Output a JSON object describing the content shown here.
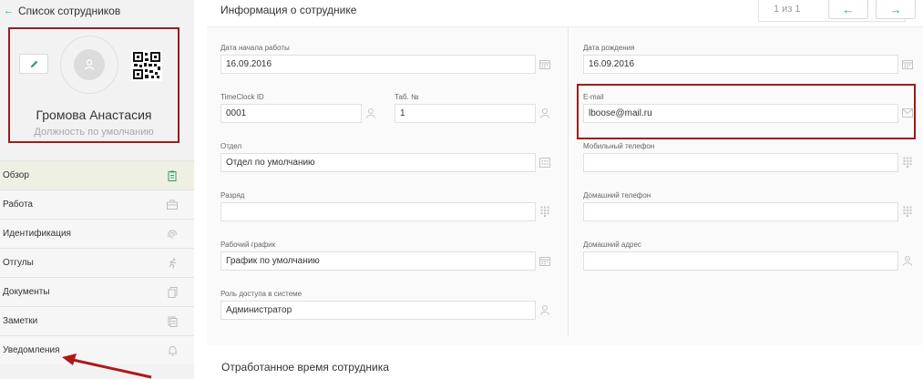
{
  "sidebar": {
    "back_link": "Список сотрудников",
    "employee_name": "Громова Анастасия",
    "employee_position": "Должность по умолчанию",
    "nav_items": [
      {
        "label": "Обзор",
        "icon": "clipboard-icon"
      },
      {
        "label": "Работа",
        "icon": "briefcase-icon"
      },
      {
        "label": "Идентификация",
        "icon": "fingerprint-icon"
      },
      {
        "label": "Отгулы",
        "icon": "running-person-icon"
      },
      {
        "label": "Документы",
        "icon": "documents-icon"
      },
      {
        "label": "Заметки",
        "icon": "notes-icon"
      },
      {
        "label": "Уведомления",
        "icon": "bell-icon"
      }
    ]
  },
  "header": {
    "title": "Информация о сотруднике",
    "pager_text": "1 из 1",
    "prev_label": "←",
    "next_label": "→"
  },
  "form": {
    "start_date": {
      "label": "Дата начала работы",
      "value": "16.09.2016"
    },
    "timeclock_id": {
      "label": "TimeClock ID",
      "value": "0001"
    },
    "tab_number": {
      "label": "Таб. №",
      "value": "1"
    },
    "department": {
      "label": "Отдел",
      "value": "Отдел по умолчанию"
    },
    "grade": {
      "label": "Разряд",
      "value": ""
    },
    "schedule": {
      "label": "Рабочий график",
      "value": "График по умолчанию"
    },
    "access_role": {
      "label": "Роль доступа в системе",
      "value": "Администратор"
    },
    "birth_date": {
      "label": "Дата рождения",
      "value": "16.09.2016"
    },
    "email": {
      "label": "E-mail",
      "value": "lboose@mail.ru"
    },
    "mobile_phone": {
      "label": "Мобильный телефон",
      "value": ""
    },
    "home_phone": {
      "label": "Домашний телефон",
      "value": ""
    },
    "home_address": {
      "label": "Домашний адрес",
      "value": ""
    }
  },
  "worktime": {
    "title": "Отработанное время сотрудника"
  },
  "colors": {
    "accent": "#2e9e6a",
    "highlight": "#9e1b1b",
    "sidebar_bg": "#f2f2f2"
  }
}
